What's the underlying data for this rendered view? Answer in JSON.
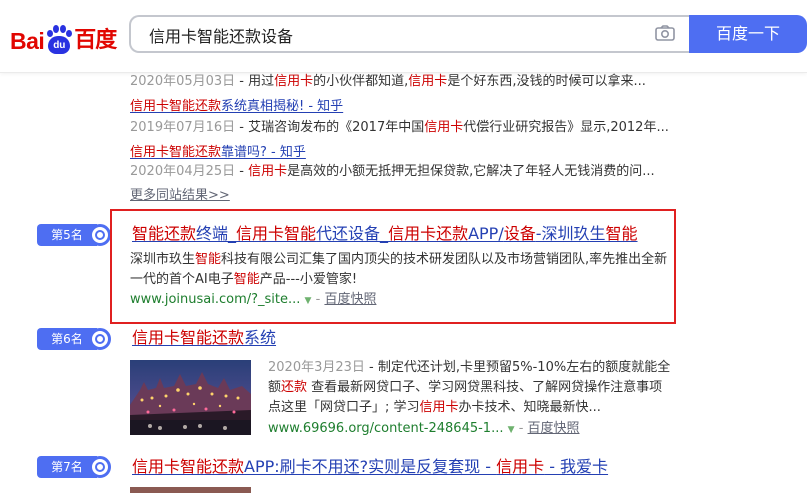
{
  "logo": {
    "bai": "Bai",
    "du": "du",
    "cn": "百度"
  },
  "search": {
    "query": "信用卡智能还款设备",
    "button": "百度一下"
  },
  "top_results": [
    {
      "date": "2020年05月03日",
      "snippet_parts": [
        " - 用过",
        "信用卡",
        "的小伙伴都知道,",
        "信用卡",
        "是个好东西,没钱的时候可以拿来..."
      ]
    },
    {
      "title_parts": [
        "信用卡智能还款",
        "系统真相揭秘! - 知乎"
      ],
      "date": "2019年07月16日",
      "snippet_parts": [
        " - 艾瑞咨询发布的《2017年中国",
        "信用卡",
        "代偿行业研究报告》显示,2012年..."
      ]
    },
    {
      "title_parts": [
        "信用卡智能还款",
        "靠谱吗? - 知乎"
      ],
      "date": "2020年04月25日",
      "snippet_parts": [
        " - ",
        "信用卡",
        "是高效的小额无抵押无担保贷款,它解决了年轻人无钱消费的问..."
      ]
    }
  ],
  "more_link": "更多同站结果>>",
  "result5": {
    "rank": "第5名",
    "title_parts": [
      "智能还款",
      "终端_",
      "信用卡智能",
      "代还设备_",
      "信用卡还款",
      "APP/",
      "设备",
      "-深圳玖生",
      "智能"
    ],
    "snippet_line1_parts": [
      "深圳市玖生",
      "智能",
      "科技有限公司汇集了国内顶尖的技术研发团队以及市场营销团队,率先推出全新"
    ],
    "snippet_line2_parts": [
      "一代的首个AI电子",
      "智能",
      "产品---小爱管家!"
    ],
    "url": "www.joinusai.com/?_site...",
    "snapshot": "百度快照"
  },
  "result6": {
    "rank": "第6名",
    "title_parts": [
      "信用卡智能还款",
      "系统"
    ],
    "date": "2020年3月23日",
    "snippet_line1": " - 制定代还计划,卡里预留5%-10%左右的额度就能全",
    "snippet_line2_parts": [
      "额",
      "还款",
      " 查看最新网贷口子、学习网贷黑科技、了解网贷操作注意事项"
    ],
    "snippet_line3_parts": [
      "点这里「网贷口子」; 学习",
      "信用卡",
      "办卡技术、知晓最新快..."
    ],
    "url": "www.69696.org/content-248645-1...",
    "snapshot": "百度快照"
  },
  "result7": {
    "rank": "第7名",
    "title_parts": [
      "信用卡智能还款",
      "APP:刷卡不用还?实则是反复套现 - ",
      "信用卡",
      " - 我爱卡"
    ]
  },
  "colors": {
    "accent": "#4e6ef2",
    "highlight": "#e02020",
    "keyword": "#cc0000",
    "link": "#2440b3",
    "url": "#1e7e2e"
  }
}
